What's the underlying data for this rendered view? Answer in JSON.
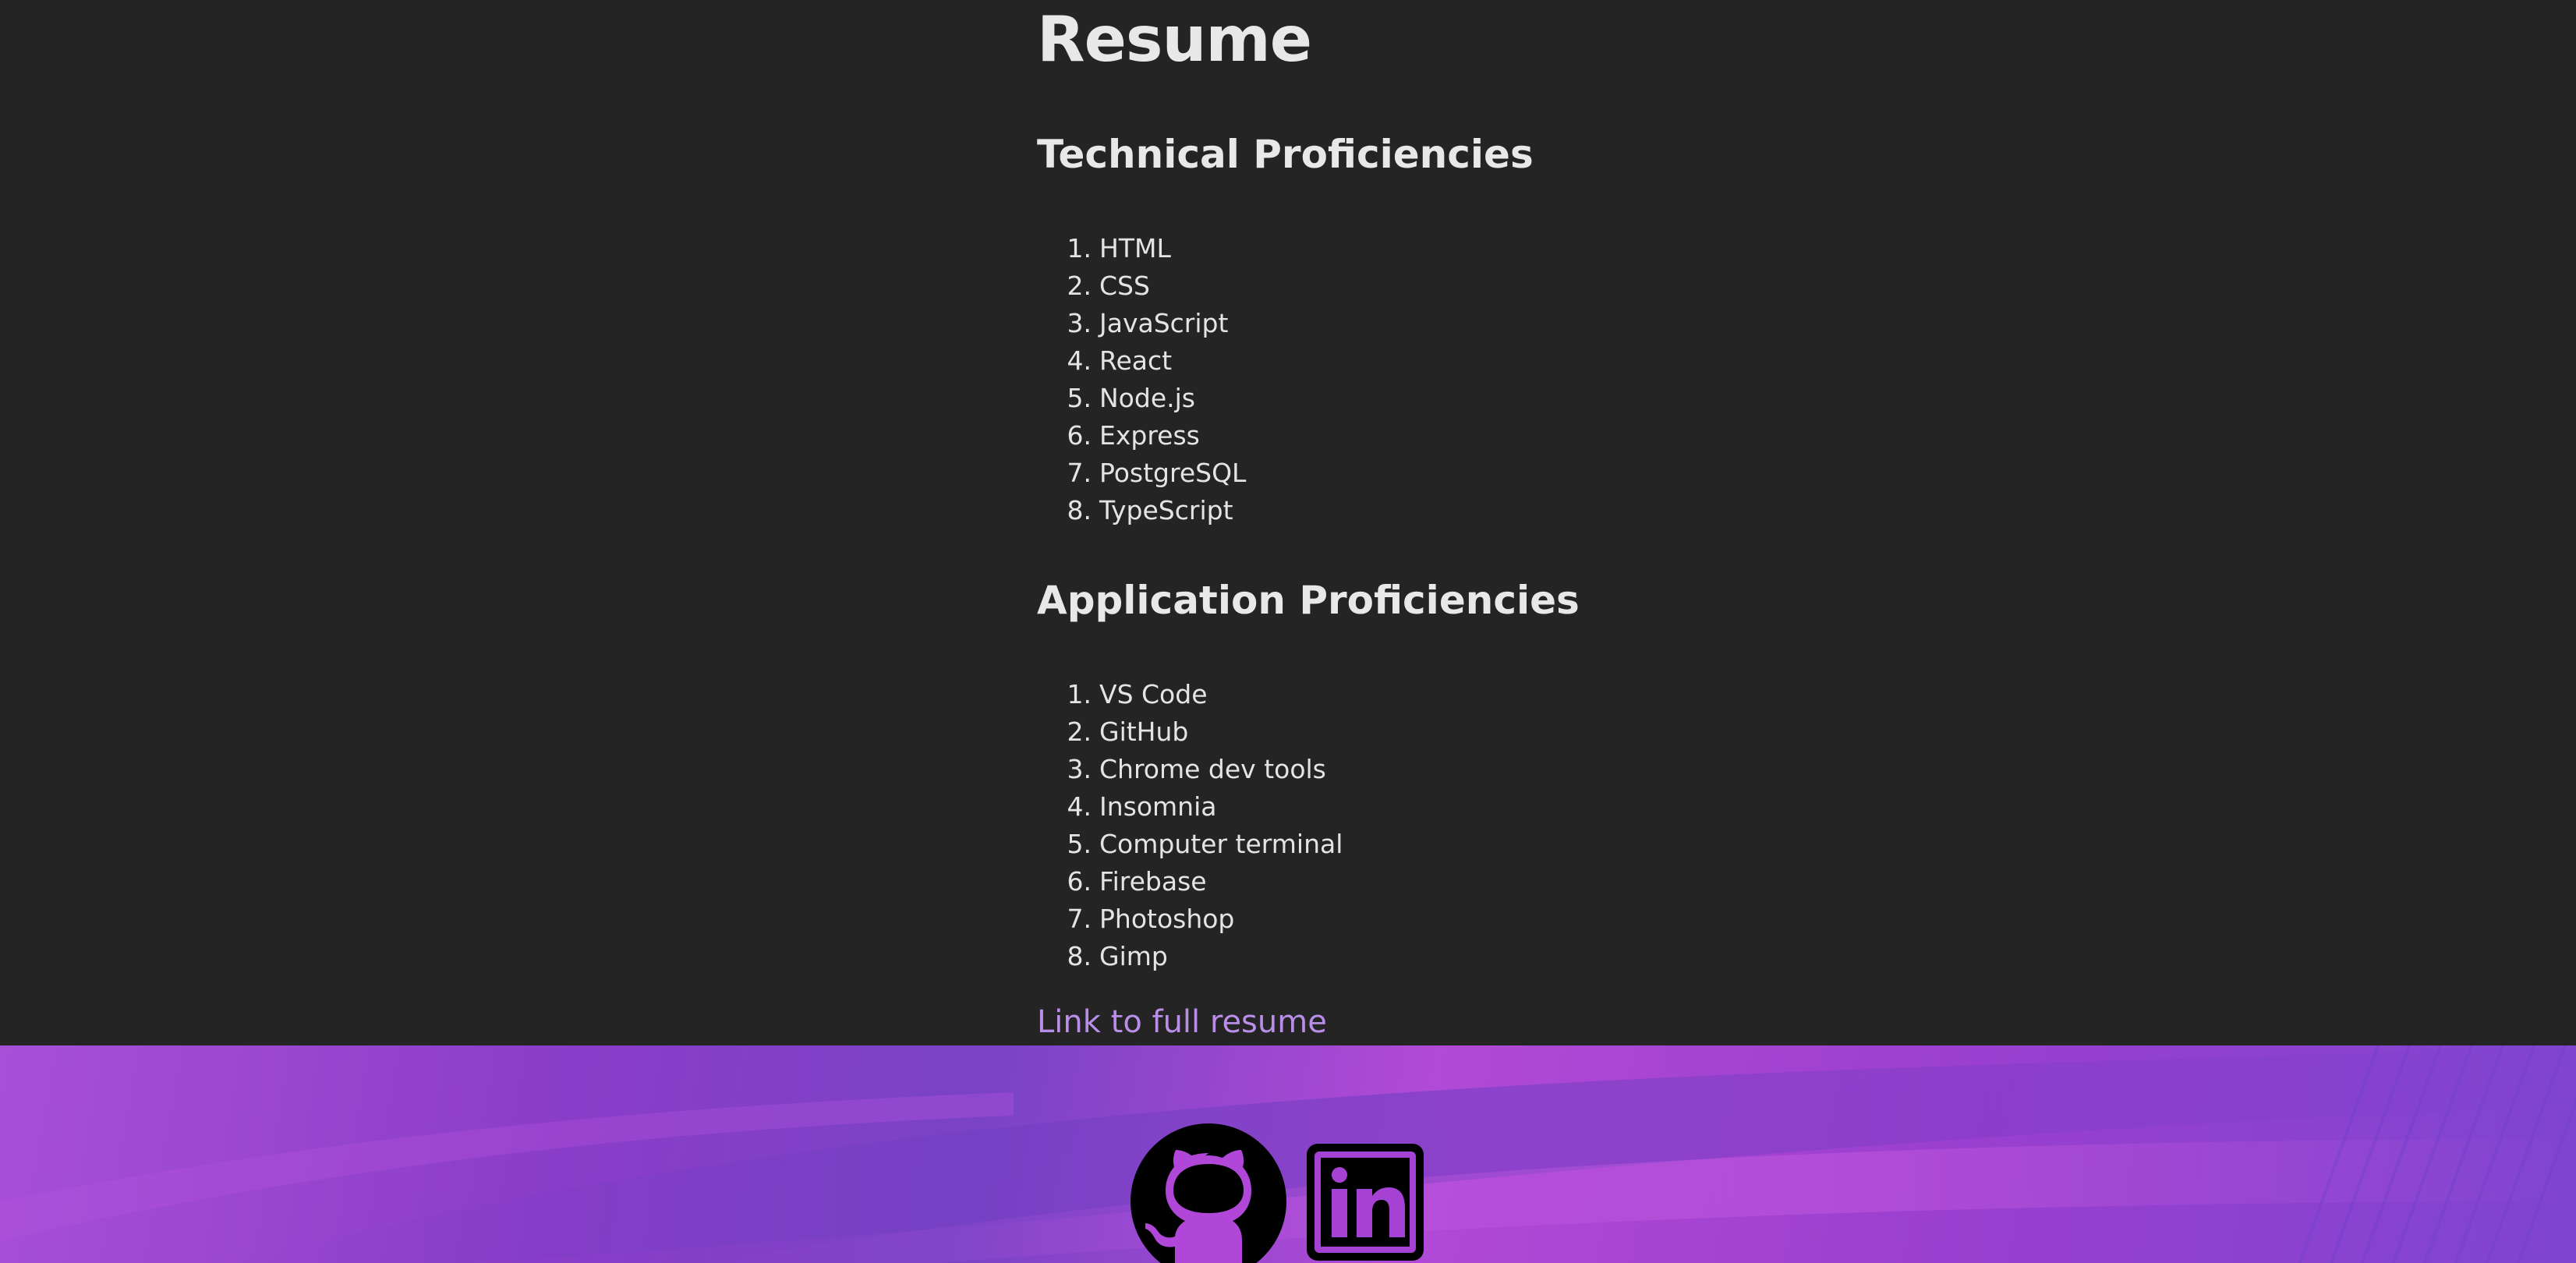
{
  "page": {
    "title": "Resume"
  },
  "technical": {
    "heading": "Technical Proficiencies",
    "items": [
      "HTML",
      "CSS",
      "JavaScript",
      "React",
      "Node.js",
      "Express",
      "PostgreSQL",
      "TypeScript"
    ]
  },
  "application": {
    "heading": "Application Proficiencies",
    "items": [
      "VS Code",
      "GitHub",
      "Chrome dev tools",
      "Insomnia",
      "Computer terminal",
      "Firebase",
      "Photoshop",
      "Gimp"
    ]
  },
  "resume_link": {
    "label": "Link to full resume"
  },
  "footer": {
    "icons": [
      "github-icon",
      "linkedin-icon"
    ]
  },
  "colors": {
    "background": "#242424",
    "text": "#e6e6e6",
    "link": "#b98ee9",
    "footer_purple": "#a84fd8"
  }
}
